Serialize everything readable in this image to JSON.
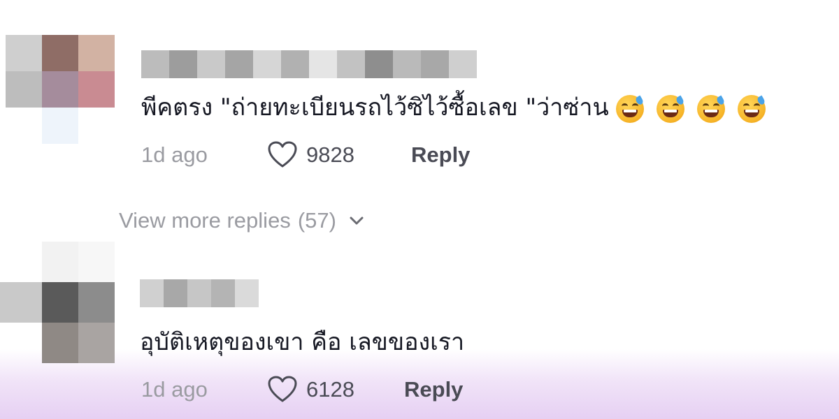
{
  "comments": [
    {
      "text": "พีคตรง \"ถ่ายทะเบียนรถไว้ซิไว้ซื้อเลข \"ว่าซ่าน",
      "emojis": [
        "grinning-sweat-emoji",
        "grinning-sweat-emoji",
        "grinning-sweat-emoji",
        "grinning-sweat-emoji"
      ],
      "time": "1d ago",
      "likes": "9828",
      "reply_label": "Reply"
    },
    {
      "text": "อุบัติเหตุของเขา คือ เลขของเรา",
      "time": "1d ago",
      "likes": "6128",
      "reply_label": "Reply"
    }
  ],
  "view_more": {
    "label": "View more replies",
    "count": "(57)",
    "icon": "chevron-down-icon"
  },
  "colors": {
    "text_primary": "#161823",
    "text_muted": "#9a9ba1",
    "action": "#4a4b55",
    "bottom_tint": "#e6d0f3"
  }
}
